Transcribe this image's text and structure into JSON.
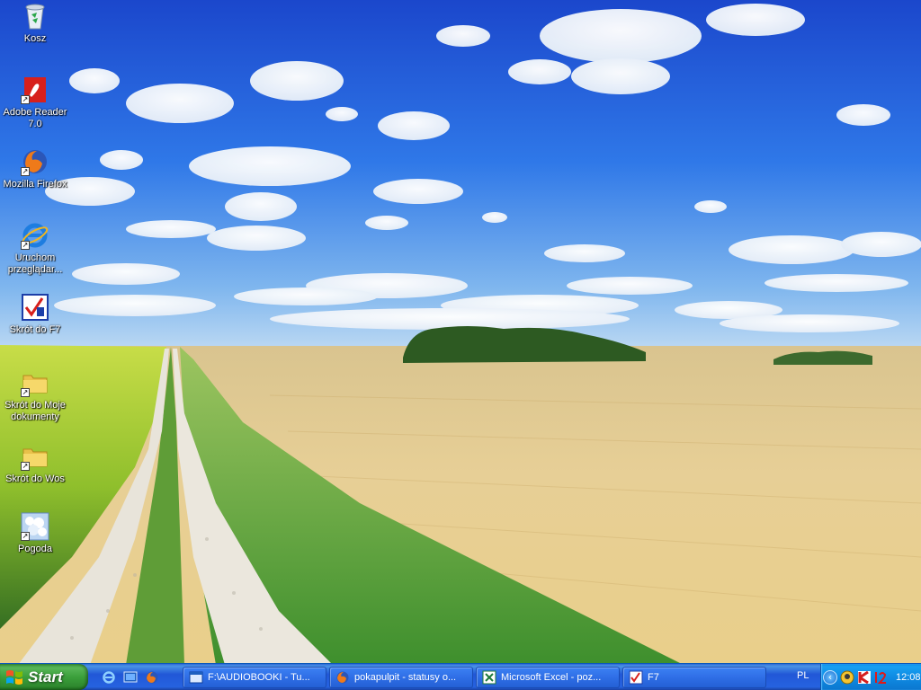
{
  "desktop": {
    "icons": [
      {
        "name": "recycle-bin-icon",
        "label": "Kosz",
        "shortcut": false
      },
      {
        "name": "adobe-reader-icon",
        "label": "Adobe Reader 7.0",
        "shortcut": true
      },
      {
        "name": "firefox-icon",
        "label": "Mozilla Firefox",
        "shortcut": true
      },
      {
        "name": "internet-explorer-icon",
        "label": "Uruchom przeglądar...",
        "shortcut": true
      },
      {
        "name": "f7-app-icon",
        "label": "Skrót do F7",
        "shortcut": true
      },
      {
        "name": "folder-icon",
        "label": "Skrót do Moje dokumenty",
        "shortcut": true
      },
      {
        "name": "folder-icon",
        "label": "Skrót do Wos",
        "shortcut": true
      },
      {
        "name": "weather-icon",
        "label": "Pogoda",
        "shortcut": true
      }
    ]
  },
  "taskbar": {
    "start_label": "Start",
    "quicklaunch": [
      "ie-icon",
      "show-desktop-icon",
      "firefox-icon"
    ],
    "tasks": [
      {
        "icon": "explorer-window-icon",
        "label": "F:\\AUDIOBOOKI - Tu..."
      },
      {
        "icon": "firefox-icon",
        "label": "pokapulpit - statusy o..."
      },
      {
        "icon": "excel-icon",
        "label": "Microsoft Excel - poz..."
      },
      {
        "icon": "f7-app-icon",
        "label": "F7"
      }
    ],
    "tray": {
      "language": "PL",
      "chevron": "‹",
      "icons": [
        "messenger-icon",
        "antivirus-k-icon",
        "gadu-gadu-12-icon"
      ],
      "clock": "12:08"
    }
  },
  "colors": {
    "sky_top": "#1e4fd1",
    "sky_horizon": "#9cc6f0",
    "field": "#e3c98a",
    "grass": "#5aa63a",
    "taskbar": "#245edb",
    "start_green": "#3b9f3b",
    "tray_blue": "#0f8be3"
  }
}
